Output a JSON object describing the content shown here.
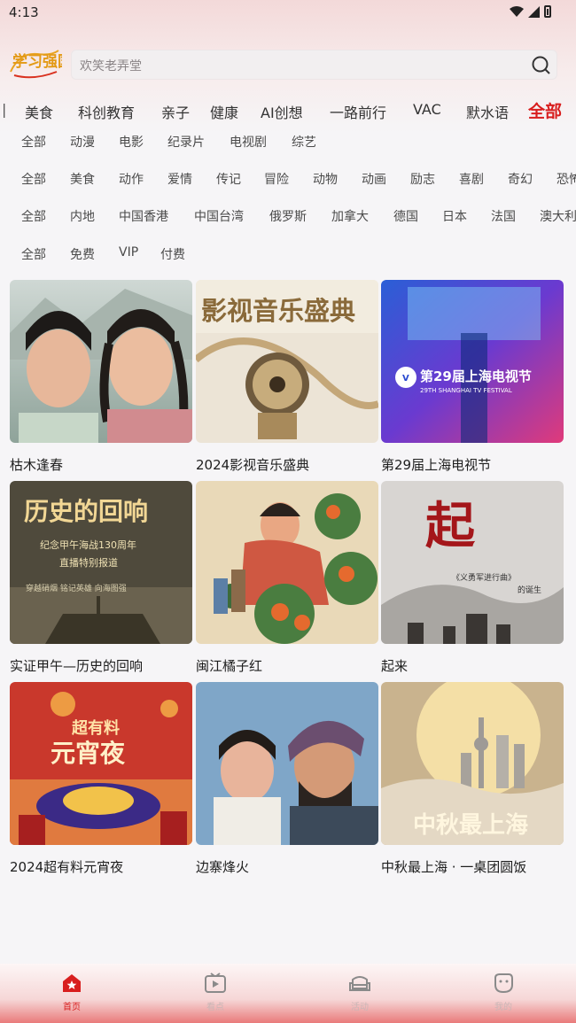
{
  "status_bar": {
    "time": "4:13"
  },
  "header": {
    "logo_text": "学习强国",
    "search_placeholder": "欢笑老弄堂"
  },
  "tabs": [
    {
      "label": "美食"
    },
    {
      "label": "科创教育"
    },
    {
      "label": "亲子"
    },
    {
      "label": "健康"
    },
    {
      "label": "AI创想"
    },
    {
      "label": "一路前行"
    },
    {
      "label": "VAC"
    },
    {
      "label": "默水语"
    },
    {
      "label": "全部",
      "active": true
    }
  ],
  "filters": {
    "type": [
      "全部",
      "动漫",
      "电影",
      "纪录片",
      "电视剧",
      "综艺"
    ],
    "genre": [
      "全部",
      "美食",
      "动作",
      "爱情",
      "传记",
      "冒险",
      "动物",
      "动画",
      "励志",
      "喜剧",
      "奇幻",
      "恐怖"
    ],
    "region": [
      "全部",
      "内地",
      "中国香港",
      "中国台湾",
      "俄罗斯",
      "加拿大",
      "德国",
      "日本",
      "法国",
      "澳大利"
    ],
    "fee": [
      "全部",
      "免费",
      "VIP",
      "付费"
    ]
  },
  "cards": [
    {
      "title": "枯木逢春"
    },
    {
      "title": "2024影视音乐盛典",
      "poster_text": "影视音乐盛典"
    },
    {
      "title": "第29届上海电视节",
      "poster_text": "第29届上海电视节",
      "poster_subtext": "29TH SHANGHAI TV FESTIVAL"
    },
    {
      "title": "实证甲午—历史的回响",
      "poster_text": "历史的回响",
      "poster_sub1": "纪念甲午海战130周年",
      "poster_sub2": "直播特别报道",
      "poster_sub3": "穿越硝烟  铭记英雄  向海图强"
    },
    {
      "title": "闽江橘子红"
    },
    {
      "title": "起来",
      "poster_text": "起",
      "poster_sub1": "《义勇军进行曲》",
      "poster_sub2": "的诞生"
    },
    {
      "title": "2024超有料元宵夜",
      "poster_text": "元宵夜",
      "poster_sub1": "超有料"
    },
    {
      "title": "边寨烽火"
    },
    {
      "title": "中秋最上海 · 一桌团圆饭",
      "poster_text": "中秋最上海"
    }
  ],
  "bottom_nav": [
    {
      "label": "首页",
      "active": true
    },
    {
      "label": "看点"
    },
    {
      "label": "活动"
    },
    {
      "label": "我的"
    }
  ]
}
